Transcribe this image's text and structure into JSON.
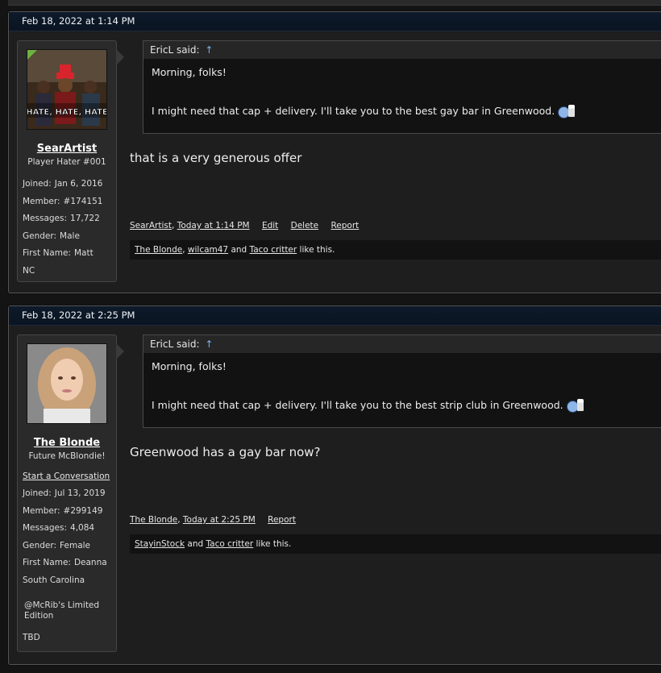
{
  "posts": [
    {
      "timestamp": "Feb 18, 2022 at 1:14 PM",
      "user": {
        "name": "SearArtist",
        "title": "Player Hater #001",
        "avatar_caption": "HATE, HATE, HATE",
        "info": [
          {
            "label": "Joined:",
            "value": "Jan 6, 2016"
          },
          {
            "label": "Member:",
            "value": "#174151"
          },
          {
            "label": "Messages:",
            "value": "17,722"
          },
          {
            "label": "Gender:",
            "value": "Male"
          },
          {
            "label": "First Name:",
            "value": "Matt"
          }
        ],
        "extra": "NC"
      },
      "quote": {
        "author": "EricL said:",
        "arrow": "↑",
        "line1": "Morning, folks!",
        "line2": "I might need that cap + delivery. I'll take you to the best gay bar in Greenwood."
      },
      "reply": "that is a very generous offer",
      "meta": {
        "author": "SearArtist",
        "time": "Today at 1:14 PM",
        "edit": "Edit",
        "delete": "Delete",
        "report": "Report"
      },
      "likes": {
        "users": [
          "The Blonde",
          "wilcam47",
          "Taco critter"
        ],
        "sep1": ", ",
        "sep2": " and ",
        "suffix": " like this."
      }
    },
    {
      "timestamp": "Feb 18, 2022 at 2:25 PM",
      "user": {
        "name": "The Blonde",
        "title": "Future McBlondie!",
        "start_conversation": "Start a Conversation",
        "info": [
          {
            "label": "Joined:",
            "value": "Jul 13, 2019"
          },
          {
            "label": "Member:",
            "value": "#299149"
          },
          {
            "label": "Messages:",
            "value": "4,084"
          },
          {
            "label": "Gender:",
            "value": "Female"
          },
          {
            "label": "First Name:",
            "value": "Deanna"
          }
        ],
        "extra": "South Carolina",
        "extra2": "@McRib's Limited Edition",
        "extra3": "TBD"
      },
      "quote": {
        "author": "EricL said:",
        "arrow": "↑",
        "line1": "Morning, folks!",
        "line2": "I might need that cap + delivery. I'll take you to the best strip club in Greenwood."
      },
      "reply": "Greenwood has a gay bar now?",
      "meta": {
        "author": "The Blonde",
        "time": "Today at 2:25 PM",
        "report": "Report"
      },
      "likes": {
        "users": [
          "StayinStock",
          "Taco critter"
        ],
        "sep2": " and ",
        "suffix": " like this."
      }
    }
  ],
  "icons": [
    "thumbs-up-smiley-icon",
    "up-arrow-icon"
  ],
  "colors": {
    "header_bg": "#0e1a2a",
    "post_bg": "#1e1e1e",
    "quote_bg": "#121212",
    "link": "#7fb2e5",
    "online_badge": "#6db33f"
  }
}
